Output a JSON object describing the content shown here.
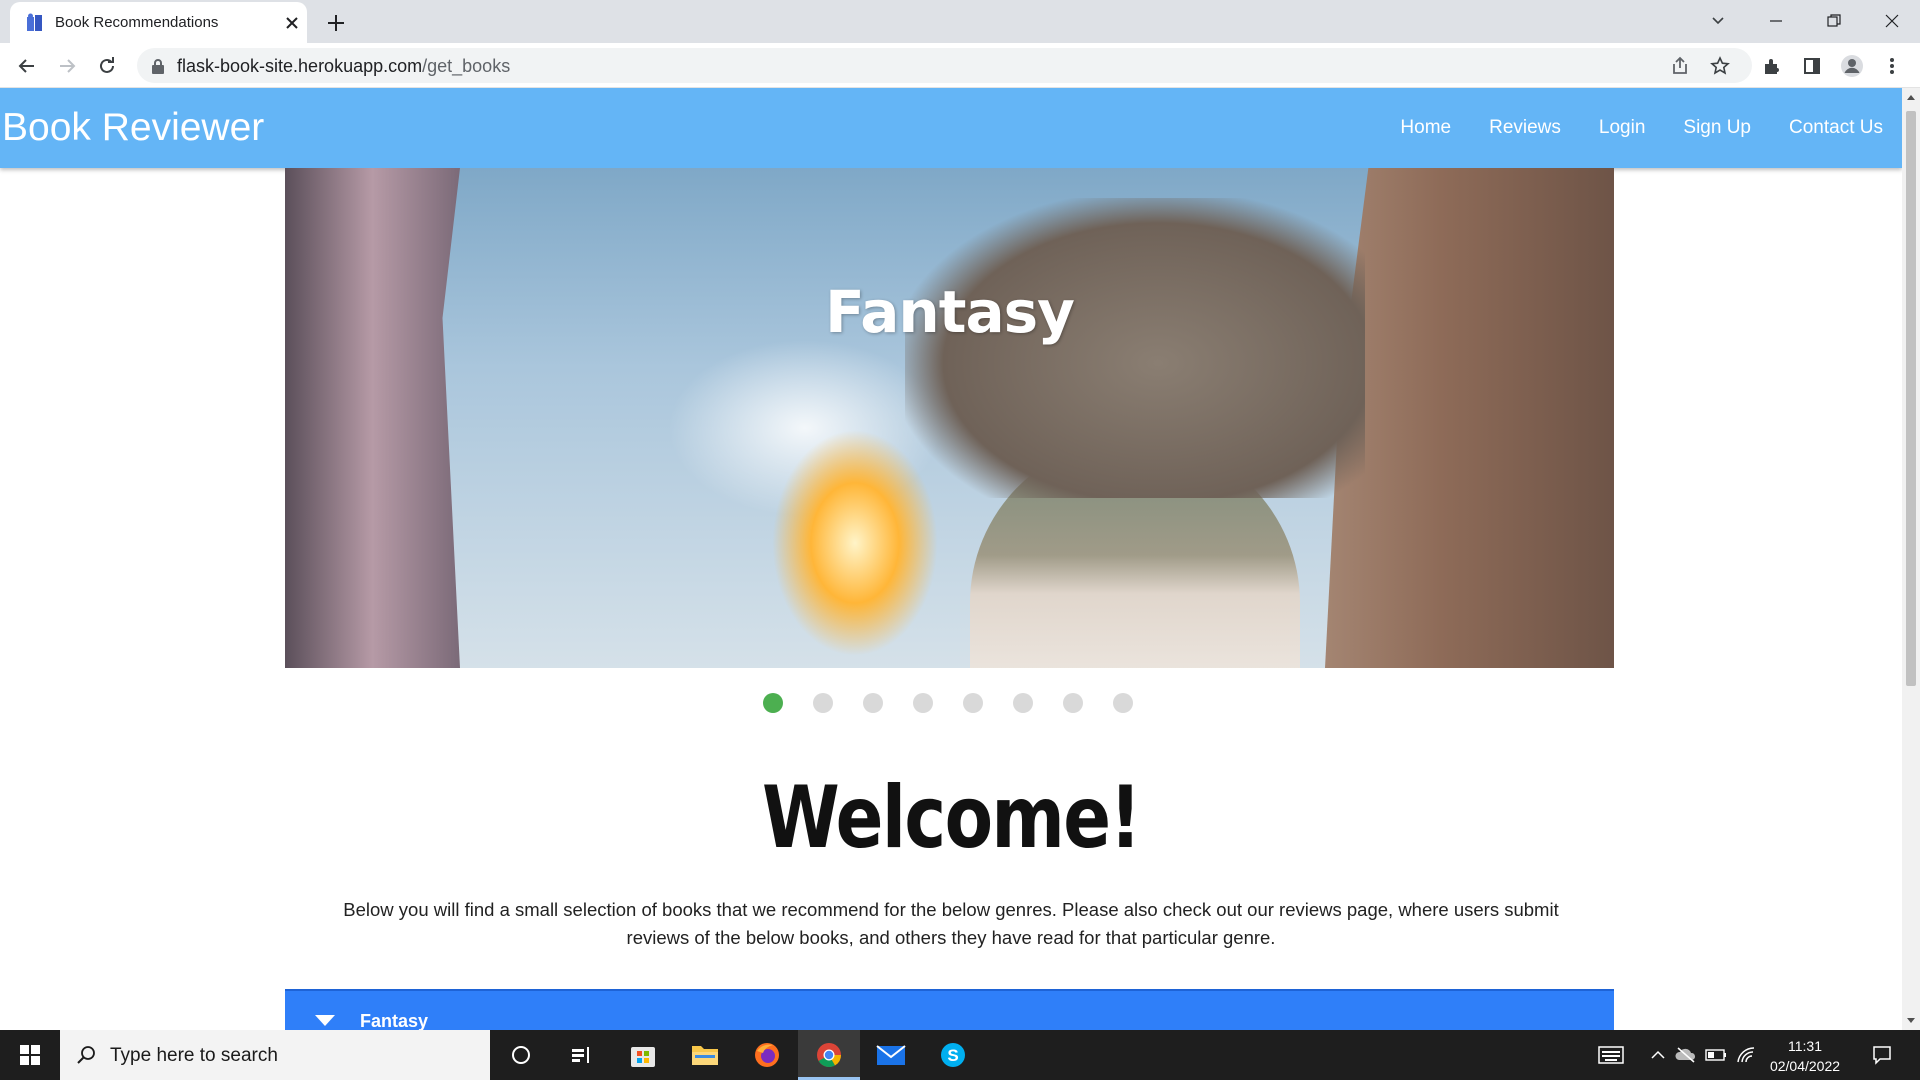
{
  "browser": {
    "tab_title": "Book Recommendations",
    "url_host": "flask-book-site.herokuapp.com",
    "url_path": "/get_books"
  },
  "site": {
    "brand": "Book Reviewer",
    "nav": [
      "Home",
      "Reviews",
      "Login",
      "Sign Up",
      "Contact Us"
    ],
    "slider": {
      "caption": "Fantasy",
      "dot_count": 8,
      "active_index": 0
    },
    "welcome_heading": "Welcome!",
    "intro_line1": "Below you will find a small selection of books that we recommend for the below genres. Please also check out our reviews page, where users submit",
    "intro_line2": "reviews of the below books, and others they have read for that particular genre.",
    "genre_section": "Fantasy"
  },
  "colors": {
    "nav_bg": "#64b5f6",
    "dot_active": "#4caf50",
    "dot_inactive": "#d9d9d9",
    "genre_bar": "#2f7ff9"
  },
  "taskbar": {
    "search_placeholder": "Type here to search",
    "apps": [
      "cortana-icon",
      "task-view-icon",
      "store-icon",
      "file-explorer-icon",
      "firefox-icon",
      "chrome-icon",
      "mail-icon",
      "skype-icon"
    ],
    "time": "11:31",
    "date": "02/04/2022"
  }
}
